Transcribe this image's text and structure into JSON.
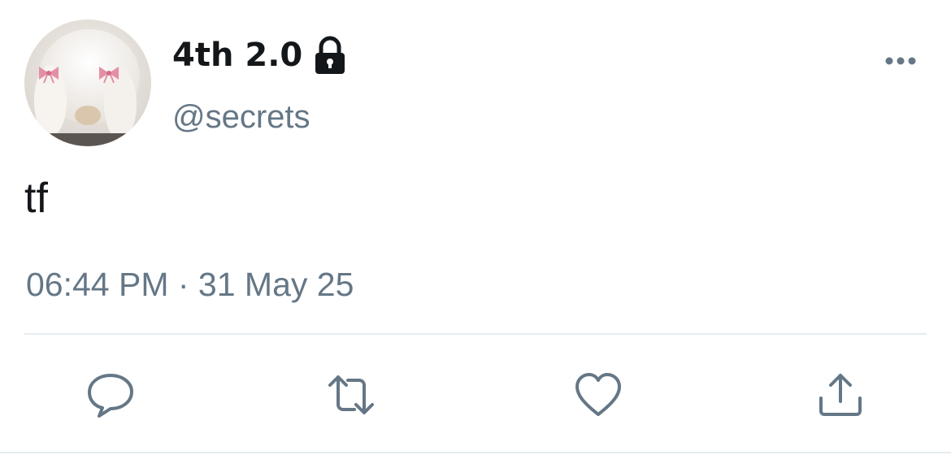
{
  "user": {
    "display_name": "4th 2.0",
    "handle": "@secrets",
    "verified_icon": "lock-icon",
    "avatar": "white-bunny-with-pink-bows"
  },
  "tweet": {
    "text": "tf",
    "timestamp": "06:44 PM · 31 May 25"
  },
  "actions": [
    {
      "icon": "reply-icon"
    },
    {
      "icon": "retweet-icon"
    },
    {
      "icon": "like-icon"
    },
    {
      "icon": "share-icon"
    }
  ],
  "colors": {
    "text_primary": "#14171a",
    "text_secondary": "#657786",
    "divider": "#e6ecf0",
    "bow_pink": "#e58fa4"
  }
}
